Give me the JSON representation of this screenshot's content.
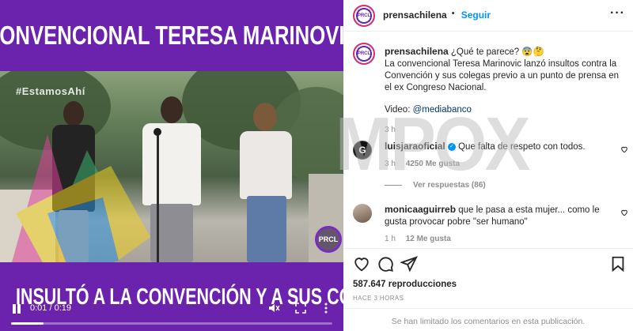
{
  "video": {
    "title_top": "CONVENCIONAL TERESA MARINOVIC",
    "title_bottom": "INSULTÓ A LA CONVENCIÓN Y A SUS COLEGAS",
    "hashtag": "#EstamosAhí",
    "badge": "PRCL",
    "time": "0:01 / 0:19",
    "progress": 0.1,
    "watermark": "MPOX"
  },
  "header": {
    "username": "prensachilena",
    "separator": "•",
    "follow_label": "Seguir",
    "more_label": "···"
  },
  "caption": {
    "username": "prensachilena",
    "question": "¿Qué te parece? 😨🤔",
    "body": "La convencional Teresa Marinovic lanzó insultos contra la Convención y sus colegas previo a un punto de prensa en el ex Congreso Nacional.",
    "video_prefix": "Video: ",
    "video_handle": "@mediabanco",
    "time": "3 h"
  },
  "comments": [
    {
      "username": "luisjaraoficial",
      "verified": true,
      "text": "Que falta de respeto con todos.",
      "time": "3 h",
      "likes": "4250 Me gusta",
      "replies": "Ver respuestas (86)"
    },
    {
      "username": "monicaaguirreb",
      "verified": false,
      "text": "que le pasa a esta mujer... como le gusta provocar pobre \"ser humano\"",
      "time": "1 h",
      "likes": "12 Me gusta"
    }
  ],
  "stats": {
    "views": "587.647 reproducciones",
    "ago": "HACE 3 HORAS"
  },
  "footer": {
    "text": "Se han limitado los comentarios en esta publicación."
  },
  "icons": {
    "like": "heart-icon",
    "comment": "comment-icon",
    "share": "share-icon",
    "save": "bookmark-icon",
    "mute": "mute-icon",
    "fullscreen": "fullscreen-icon"
  },
  "colors": {
    "brand_purple": "#6b22ad",
    "link": "#0095f6",
    "muted": "#8e8e8e"
  }
}
